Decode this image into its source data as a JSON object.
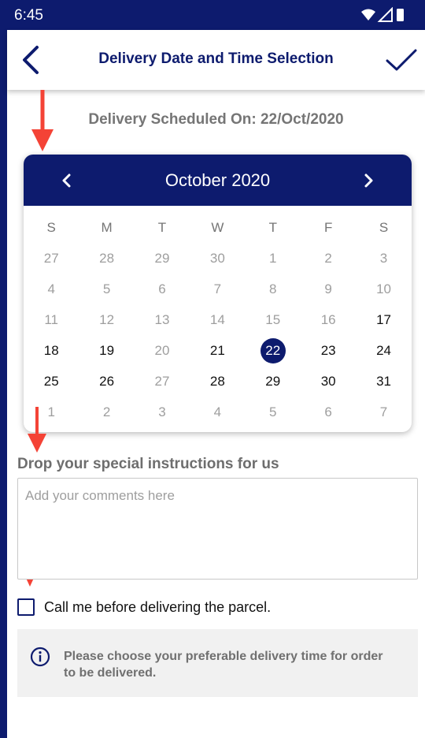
{
  "status_bar": {
    "time": "6:45",
    "icons": [
      "wifi-icon",
      "cell-signal-icon",
      "battery-icon"
    ]
  },
  "app_bar": {
    "title": "Delivery Date and Time Selection",
    "back_icon": "back-arrow-icon",
    "confirm_icon": "checkmark-icon"
  },
  "scheduled": {
    "text": "Delivery Scheduled On:  22/Oct/2020"
  },
  "calendar": {
    "month_label": "October  2020",
    "prev_icon": "chevron-left-icon",
    "next_icon": "chevron-right-icon",
    "weekdays": [
      "S",
      "M",
      "T",
      "W",
      "T",
      "F",
      "S"
    ],
    "weeks": [
      [
        "27",
        "28",
        "29",
        "30",
        "1",
        "2",
        "3"
      ],
      [
        "4",
        "5",
        "6",
        "7",
        "8",
        "9",
        "10"
      ],
      [
        "11",
        "12",
        "13",
        "14",
        "15",
        "16",
        "17"
      ],
      [
        "18",
        "19",
        "20",
        "21",
        "22",
        "23",
        "24"
      ],
      [
        "25",
        "26",
        "27",
        "28",
        "29",
        "30",
        "31"
      ],
      [
        "1",
        "2",
        "3",
        "4",
        "5",
        "6",
        "7"
      ]
    ],
    "selected": "22"
  },
  "instructions": {
    "label": "Drop your special instructions for us",
    "placeholder": "Add your comments here",
    "value": ""
  },
  "call_option": {
    "label": "Call me before delivering the parcel.",
    "checked": false
  },
  "info": {
    "icon": "info-icon",
    "text": "Please choose your preferable delivery time for order to be delivered."
  },
  "colors": {
    "primary": "#0d1b6e",
    "annotation_arrow": "#f44336",
    "muted_text": "#9e9e9e",
    "info_background": "#f1f1f1"
  }
}
